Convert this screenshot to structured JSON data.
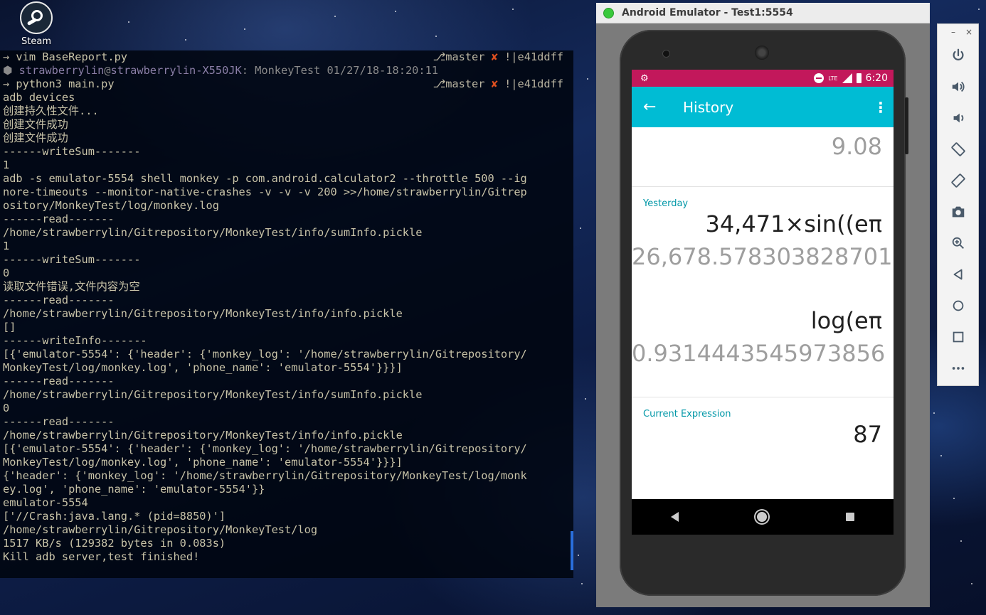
{
  "desktop": {
    "icon_label": "Steam"
  },
  "terminal": {
    "lines": [
      {
        "kind": "prompt_cmd",
        "text": "vim BaseReport.py",
        "branch": "master",
        "x": "✘",
        "rest": " !|e41ddff"
      },
      {
        "kind": "status",
        "user": "strawberrylin",
        "host": "strawberrylin-X550JK",
        "text": ": MonkeyTest 01/27/18-18:20:11"
      },
      {
        "kind": "prompt_cmd",
        "text": "python3 main.py",
        "branch": "master",
        "x": "✘",
        "rest": " !|e41ddff"
      },
      {
        "kind": "plain",
        "text": "adb devices"
      },
      {
        "kind": "plain",
        "text": "创建持久性文件..."
      },
      {
        "kind": "plain",
        "text": "创建文件成功"
      },
      {
        "kind": "plain",
        "text": "创建文件成功"
      },
      {
        "kind": "plain",
        "text": "------writeSum-------"
      },
      {
        "kind": "plain",
        "text": "1"
      },
      {
        "kind": "plain",
        "text": "adb -s emulator-5554 shell monkey -p com.android.calculator2 --throttle 500 --ig"
      },
      {
        "kind": "plain",
        "text": "nore-timeouts --monitor-native-crashes -v -v -v 200 >>/home/strawberrylin/Gitrep"
      },
      {
        "kind": "plain",
        "text": "ository/MonkeyTest/log/monkey.log"
      },
      {
        "kind": "plain",
        "text": "------read-------"
      },
      {
        "kind": "plain",
        "text": "/home/strawberrylin/Gitrepository/MonkeyTest/info/sumInfo.pickle"
      },
      {
        "kind": "plain",
        "text": "1"
      },
      {
        "kind": "plain",
        "text": "------writeSum-------"
      },
      {
        "kind": "plain",
        "text": "0"
      },
      {
        "kind": "plain",
        "text": "读取文件错误,文件内容为空"
      },
      {
        "kind": "plain",
        "text": "------read-------"
      },
      {
        "kind": "plain",
        "text": "/home/strawberrylin/Gitrepository/MonkeyTest/info/info.pickle"
      },
      {
        "kind": "plain",
        "text": "[]"
      },
      {
        "kind": "plain",
        "text": "------writeInfo-------"
      },
      {
        "kind": "plain",
        "text": "[{'emulator-5554': {'header': {'monkey_log': '/home/strawberrylin/Gitrepository/"
      },
      {
        "kind": "plain",
        "text": "MonkeyTest/log/monkey.log', 'phone_name': 'emulator-5554'}}}]"
      },
      {
        "kind": "plain",
        "text": "------read-------"
      },
      {
        "kind": "plain",
        "text": "/home/strawberrylin/Gitrepository/MonkeyTest/info/sumInfo.pickle"
      },
      {
        "kind": "plain",
        "text": "0"
      },
      {
        "kind": "plain",
        "text": "------read-------"
      },
      {
        "kind": "plain",
        "text": "/home/strawberrylin/Gitrepository/MonkeyTest/info/info.pickle"
      },
      {
        "kind": "plain",
        "text": "[{'emulator-5554': {'header': {'monkey_log': '/home/strawberrylin/Gitrepository/"
      },
      {
        "kind": "plain",
        "text": "MonkeyTest/log/monkey.log', 'phone_name': 'emulator-5554'}}}]"
      },
      {
        "kind": "plain",
        "text": "{'header': {'monkey_log': '/home/strawberrylin/Gitrepository/MonkeyTest/log/monk"
      },
      {
        "kind": "plain",
        "text": "ey.log', 'phone_name': 'emulator-5554'}}"
      },
      {
        "kind": "plain",
        "text": "emulator-5554"
      },
      {
        "kind": "plain",
        "text": "['//Crash:java.lang.* (pid=8850)']"
      },
      {
        "kind": "plain",
        "text": "/home/strawberrylin/Gitrepository/MonkeyTest/log"
      },
      {
        "kind": "plain",
        "text": "1517 KB/s (129382 bytes in 0.083s)"
      },
      {
        "kind": "plain",
        "text": "Kill adb server,test finished!"
      }
    ]
  },
  "emulator": {
    "window_title": "Android Emulator - Test1:5554",
    "status_bar": {
      "lte": "LTE",
      "time": "6:20"
    },
    "app_bar": {
      "title": "History"
    },
    "history": {
      "top_value": "9.08",
      "yesterday_label": "Yesterday",
      "entries": [
        {
          "expression": "34,471×sin((eπ",
          "result": "26,678.578303828701"
        },
        {
          "expression": "log(eπ",
          "result": "0.9314443545973856"
        }
      ],
      "current_label": "Current Expression",
      "current_value": "87"
    }
  },
  "toolbar": {
    "minimize": "–",
    "close": "×",
    "buttons": [
      "power-icon",
      "volume-up-icon",
      "volume-down-icon",
      "rotate-left-icon",
      "rotate-right-icon",
      "camera-icon",
      "zoom-icon",
      "back-icon",
      "home-icon",
      "overview-icon",
      "more-icon"
    ]
  }
}
